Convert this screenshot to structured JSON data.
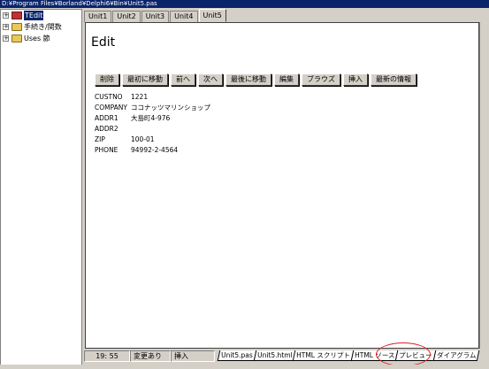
{
  "window": {
    "title": "D:¥Program Files¥Borland¥Delphi6¥Bin¥Unit5.pas"
  },
  "tree": {
    "items": [
      {
        "label": "TEdit",
        "selected": true,
        "icon": "component-icon",
        "expander": "+"
      },
      {
        "label": "手続き/関数",
        "selected": false,
        "icon": "folder-icon",
        "expander": "+"
      },
      {
        "label": "Uses 節",
        "selected": false,
        "icon": "folder-icon",
        "expander": "+"
      }
    ]
  },
  "top_tabs": [
    "Unit1",
    "Unit2",
    "Unit3",
    "Unit4",
    "Unit5"
  ],
  "editor": {
    "heading": "Edit",
    "buttons": [
      "削除",
      "最初に移動",
      "前へ",
      "次へ",
      "最後に移動",
      "編集",
      "ブラウズ",
      "挿入",
      "最新の情報"
    ],
    "fields": [
      {
        "key": "CUSTNO",
        "value": "1221"
      },
      {
        "key": "COMPANY",
        "value": "ココナッツマリンショップ"
      },
      {
        "key": "ADDR1",
        "value": "大島町4-976"
      },
      {
        "key": "ADDR2",
        "value": ""
      },
      {
        "key": "ZIP",
        "value": "100-01"
      },
      {
        "key": "PHONE",
        "value": "94992-2-4564"
      }
    ]
  },
  "status": {
    "position": "19: 55",
    "modified": "変更あり",
    "mode": "挿入"
  },
  "bottom_tabs": [
    "Unit5.pas",
    "Unit5.html",
    "HTML スクリプト",
    "HTML ソース",
    "プレビュー",
    "ダイアグラム"
  ],
  "colors": {
    "titlebar": "#0a246a",
    "highlight_circle": "#e02020",
    "chrome": "#d4d0c8"
  }
}
